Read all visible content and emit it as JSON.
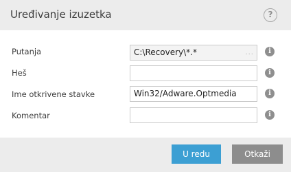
{
  "dialog": {
    "title": "Uređivanje izuzetka",
    "help_icon": "?"
  },
  "form": {
    "path_label": "Putanja",
    "path_value": "C:\\Recovery\\*.*",
    "path_browse": "...",
    "hash_label": "Heš",
    "hash_value": "",
    "detected_label": "Ime otkrivene stavke",
    "detected_value": "Win32/Adware.Optmedia",
    "comment_label": "Komentar",
    "comment_value": "",
    "info_icon": "i"
  },
  "footer": {
    "ok_label": "U redu",
    "cancel_label": "Otkaži"
  },
  "colors": {
    "ok_button": "#3c9fd3",
    "cancel_button": "#8d8d8d",
    "header_bg": "#ececec"
  }
}
